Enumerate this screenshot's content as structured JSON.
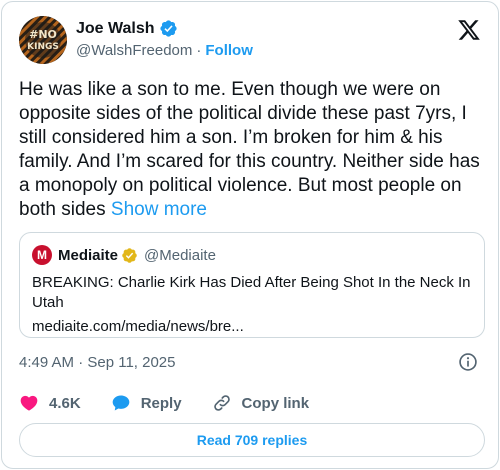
{
  "author": {
    "name": "Joe Walsh",
    "handle": "@WalshFreedom",
    "separator": "·",
    "follow_label": "Follow",
    "avatar_text": "NO KINGS"
  },
  "tweet": {
    "text": "He was like a son to me. Even though we were on opposite sides of the political divide these past 7yrs, I still considered him a son. I’m broken for him & his family. And I’m scared for this country. Neither side has a monopoly on political violence. But most people on both sides",
    "show_more_label": "Show more"
  },
  "quote": {
    "name": "Mediaite",
    "handle": "@Mediaite",
    "avatar_letter": "M",
    "text": "BREAKING: Charlie Kirk Has Died After Being Shot In the Neck In Utah",
    "link": "mediaite.com/media/news/bre..."
  },
  "meta": {
    "timestamp": "4:49 AM · Sep 11, 2025"
  },
  "actions": {
    "likes": "4.6K",
    "reply_label": "Reply",
    "copy_link_label": "Copy link"
  },
  "replies_button": "Read 709 replies",
  "colors": {
    "accent": "#1d9bf0",
    "like": "#f91880",
    "verified_blue": "#1d9bf0",
    "verified_gold": "#e2b719",
    "mediaite_red": "#c8102e"
  },
  "icons": [
    "verified-badge-icon",
    "x-logo-icon",
    "gold-verified-badge-icon",
    "info-icon",
    "heart-icon",
    "reply-bubble-icon",
    "link-icon"
  ]
}
